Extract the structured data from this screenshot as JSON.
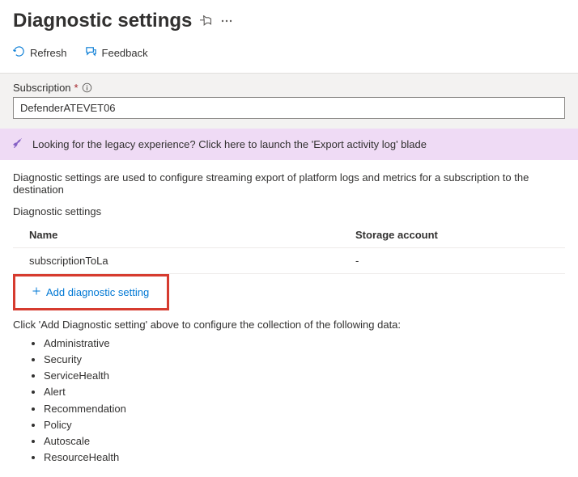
{
  "header": {
    "title": "Diagnostic settings"
  },
  "toolbar": {
    "refresh": "Refresh",
    "feedback": "Feedback"
  },
  "subscription": {
    "label": "Subscription",
    "value": "DefenderATEVET06"
  },
  "banner": {
    "text": "Looking for the legacy experience? Click here to launch the 'Export activity log' blade"
  },
  "description": "Diagnostic settings are used to configure streaming export of platform logs and metrics for a subscription to the destination",
  "section_label": "Diagnostic settings",
  "table": {
    "col_name": "Name",
    "col_storage": "Storage account",
    "rows": [
      {
        "name": "subscriptionToLa",
        "storage": "-"
      }
    ]
  },
  "add_link": "Add diagnostic setting",
  "instructions": "Click 'Add Diagnostic setting' above to configure the collection of the following data:",
  "data_types": [
    "Administrative",
    "Security",
    "ServiceHealth",
    "Alert",
    "Recommendation",
    "Policy",
    "Autoscale",
    "ResourceHealth"
  ]
}
